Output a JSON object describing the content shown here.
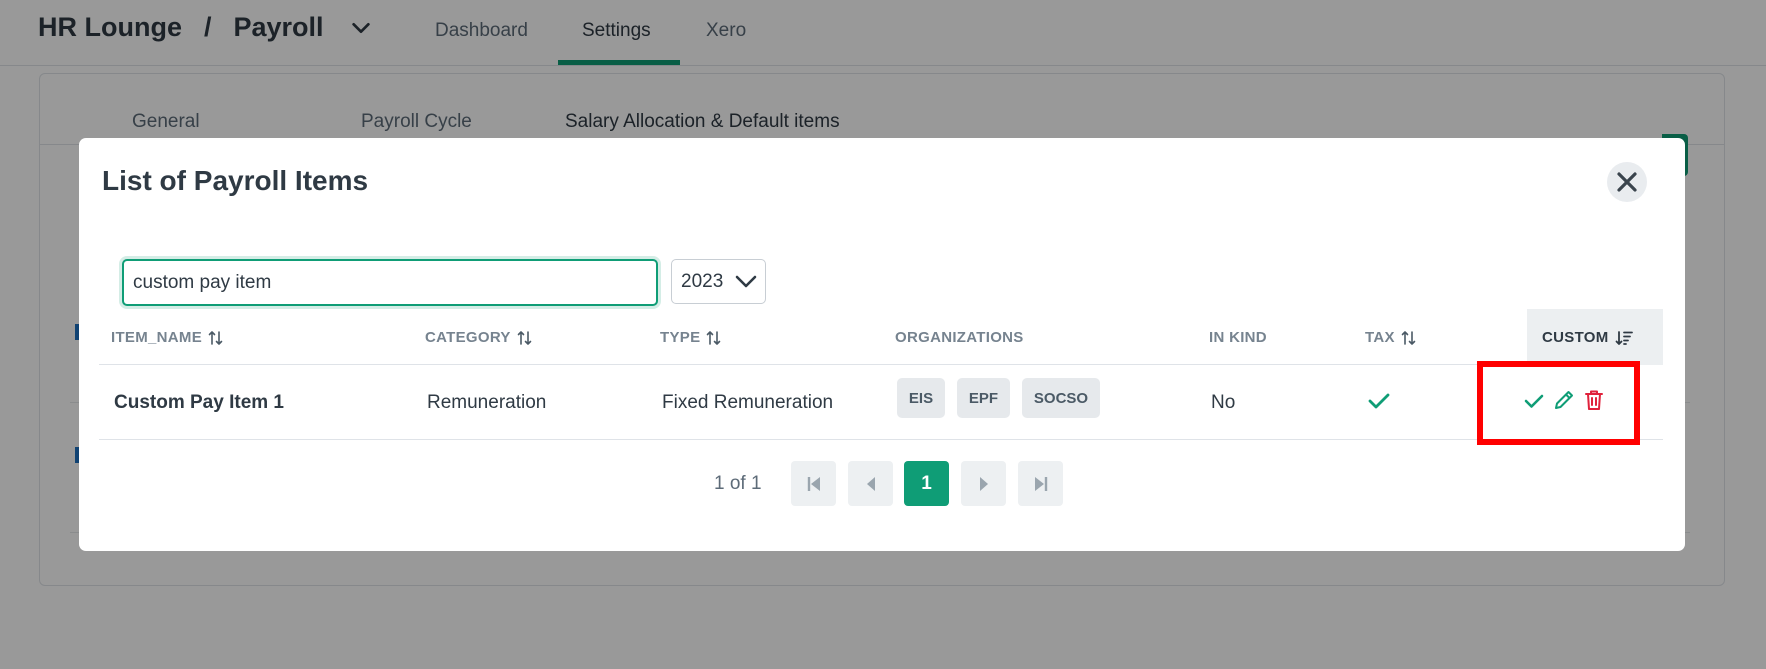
{
  "header": {
    "org_name": "HR Lounge",
    "separator": "/",
    "module_name": "Payroll",
    "tabs": [
      {
        "label": "Dashboard"
      },
      {
        "label": "Settings"
      },
      {
        "label": "Xero"
      }
    ],
    "active_tab": "Settings"
  },
  "settings": {
    "subtabs": [
      {
        "label": "General"
      },
      {
        "label": "Payroll Cycle"
      },
      {
        "label": "Salary Allocation & Default items"
      }
    ],
    "active_subtab": "Salary Allocation & Default items"
  },
  "modal": {
    "title": "List of Payroll Items",
    "search": {
      "value": "custom pay item"
    },
    "year_select": {
      "value": "2023"
    },
    "columns": [
      {
        "key": "item_name",
        "label": "ITEM_NAME",
        "sortable": true
      },
      {
        "key": "category",
        "label": "CATEGORY",
        "sortable": true
      },
      {
        "key": "type",
        "label": "TYPE",
        "sortable": true
      },
      {
        "key": "organizations",
        "label": "ORGANIZATIONS",
        "sortable": false
      },
      {
        "key": "in_kind",
        "label": "IN KIND",
        "sortable": false
      },
      {
        "key": "tax",
        "label": "TAX",
        "sortable": true
      },
      {
        "key": "custom",
        "label": "CUSTOM",
        "sortable": true,
        "sorted": "descending"
      }
    ],
    "rows": [
      {
        "item_name": "Custom Pay Item 1",
        "category": "Remuneration",
        "type": "Fixed Remuneration",
        "organizations": [
          "EIS",
          "EPF",
          "SOCSO"
        ],
        "in_kind": "No",
        "tax": "check-icon",
        "actions": [
          "check-icon",
          "pencil-icon",
          "trash-icon"
        ]
      }
    ],
    "pagination": {
      "label": "1 of 1",
      "current_page": "1"
    }
  },
  "colors": {
    "accent": "#0f9d76",
    "danger": "#e0223c",
    "highlight": "#ff0000",
    "link": "#1c6fbf"
  }
}
